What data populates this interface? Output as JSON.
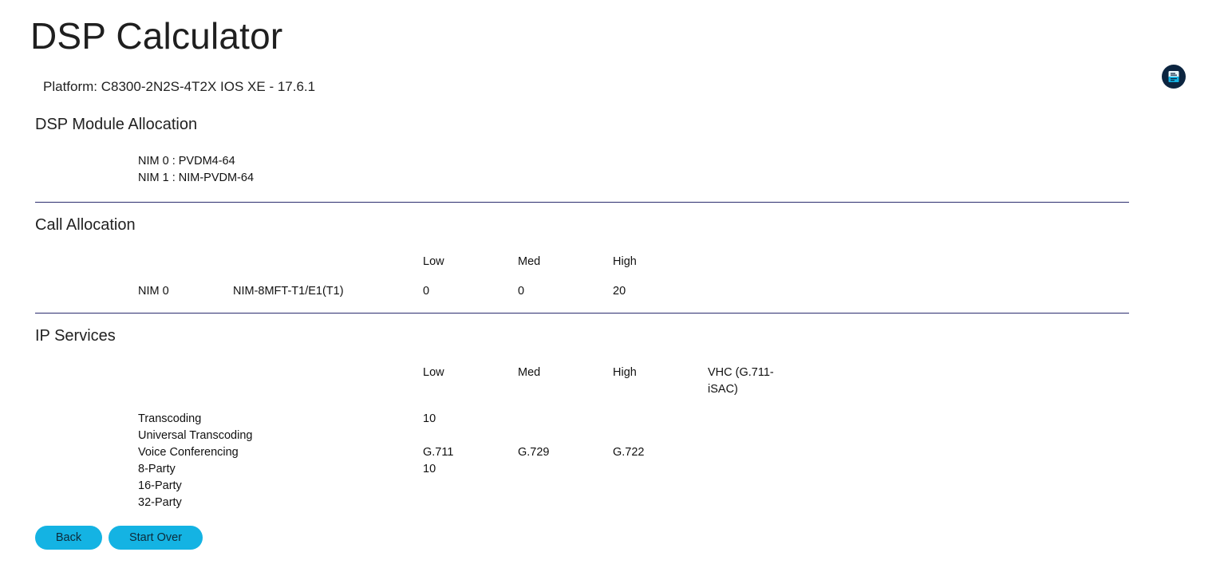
{
  "app": {
    "title": "DSP Calculator"
  },
  "platform": {
    "text": "Platform: C8300-2N2S-4T2X IOS XE - 17.6.1"
  },
  "dsp_module": {
    "title": "DSP Module Allocation",
    "items": [
      "NIM 0 : PVDM4-64",
      "NIM 1 : NIM-PVDM-64"
    ]
  },
  "call_allocation": {
    "title": "Call Allocation",
    "headers": [
      "Low",
      "Med",
      "High"
    ],
    "row": {
      "slot": "NIM 0",
      "module": "NIM-8MFT-T1/E1(T1)",
      "low": "0",
      "med": "0",
      "high": "20"
    }
  },
  "ip_services": {
    "title": "IP Services",
    "headers": [
      "Low",
      "Med",
      "High"
    ],
    "vhc_header_line1": "VHC (G.711-",
    "vhc_header_line2": "iSAC)",
    "transcoding": {
      "label": "Transcoding",
      "low": "10"
    },
    "universal_transcoding": {
      "label": "Universal Transcoding"
    },
    "voice_conferencing": {
      "label": "Voice Conferencing",
      "codecs": [
        "G.711",
        "G.729",
        "G.722"
      ]
    },
    "party_8": {
      "label": "8-Party",
      "value": "10"
    },
    "party_16": {
      "label": "16-Party"
    },
    "party_32": {
      "label": "32-Party"
    }
  },
  "buttons": {
    "back": "Back",
    "start_over": "Start Over"
  },
  "icons": {
    "report": "report-icon"
  },
  "colors": {
    "accent": "#14b3e3",
    "divider": "#2b2d6e",
    "icon_bg": "#0c2540"
  }
}
